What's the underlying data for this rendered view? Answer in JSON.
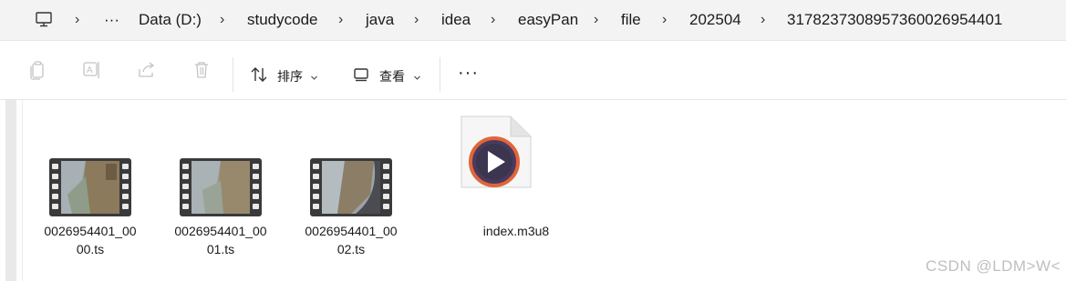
{
  "breadcrumb": {
    "ellipsis": "···",
    "items": [
      "Data (D:)",
      "studycode",
      "java",
      "idea",
      "easyPan",
      "file",
      "202504",
      "317823730895736002695 4401"
    ]
  },
  "toolbar": {
    "sort_label": "排序",
    "view_label": "查看",
    "more_label": "···"
  },
  "files": [
    {
      "name_line1": "0026954401_00",
      "name_line2": "00.ts",
      "type": "video-thumbnail"
    },
    {
      "name_line1": "0026954401_00",
      "name_line2": "01.ts",
      "type": "video-thumbnail"
    },
    {
      "name_line1": "0026954401_00",
      "name_line2": "02.ts",
      "type": "video-thumbnail"
    },
    {
      "name_line1": "index.m3u8",
      "name_line2": "",
      "type": "playlist-icon"
    }
  ],
  "watermark": "CSDN @LDM>W<"
}
